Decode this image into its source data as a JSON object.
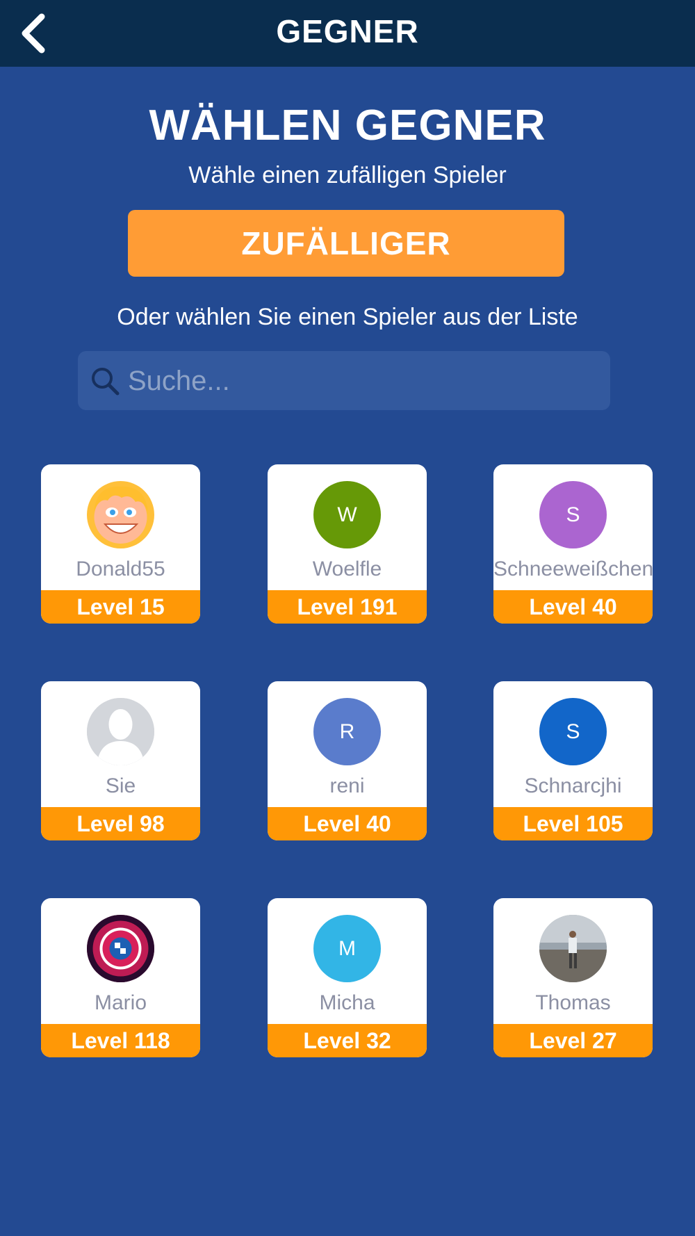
{
  "header": {
    "title": "GEGNER",
    "back_icon": "chevron-left-icon"
  },
  "main": {
    "heading": "WÄHLEN GEGNER",
    "subtext": "Wähle einen zufälligen Spieler",
    "random_button": "ZUFÄLLIGER",
    "or_text": "Oder wählen Sie einen Spieler aus der Liste",
    "search": {
      "placeholder": "Suche...",
      "value": "",
      "icon": "search-icon"
    }
  },
  "players": [
    {
      "name": "Donald55",
      "level": "Level 15",
      "avatar_type": "cartoon-face",
      "avatar_letter": "",
      "avatar_color": "#ffc03a"
    },
    {
      "name": "Woelfle",
      "level": "Level 191",
      "avatar_type": "letter",
      "avatar_letter": "W",
      "avatar_color": "#669907"
    },
    {
      "name": "Schneeweißchen",
      "level": "Level 40",
      "avatar_type": "letter",
      "avatar_letter": "S",
      "avatar_color": "#ab65d0"
    },
    {
      "name": "Sie",
      "level": "Level 98",
      "avatar_type": "silhouette",
      "avatar_letter": "",
      "avatar_color": "#d3d6db"
    },
    {
      "name": "reni",
      "level": "Level 40",
      "avatar_type": "letter",
      "avatar_letter": "R",
      "avatar_color": "#5a7ccc"
    },
    {
      "name": "Schnarcjhi",
      "level": "Level 105",
      "avatar_type": "letter",
      "avatar_letter": "S",
      "avatar_color": "#1266c9"
    },
    {
      "name": "Mario",
      "level": "Level 118",
      "avatar_type": "club-logo-photo",
      "avatar_letter": "",
      "avatar_color": "#7a1c3c"
    },
    {
      "name": "Micha",
      "level": "Level 32",
      "avatar_type": "letter",
      "avatar_letter": "M",
      "avatar_color": "#32b5e6"
    },
    {
      "name": "Thomas",
      "level": "Level 27",
      "avatar_type": "beach-photo",
      "avatar_letter": "",
      "avatar_color": "#8f9aa3"
    }
  ],
  "colors": {
    "background": "#234a92",
    "topbar": "#0a2d4e",
    "accent_button": "#ff9c35",
    "level_band": "#ff9806",
    "search_field": "#33599e"
  }
}
